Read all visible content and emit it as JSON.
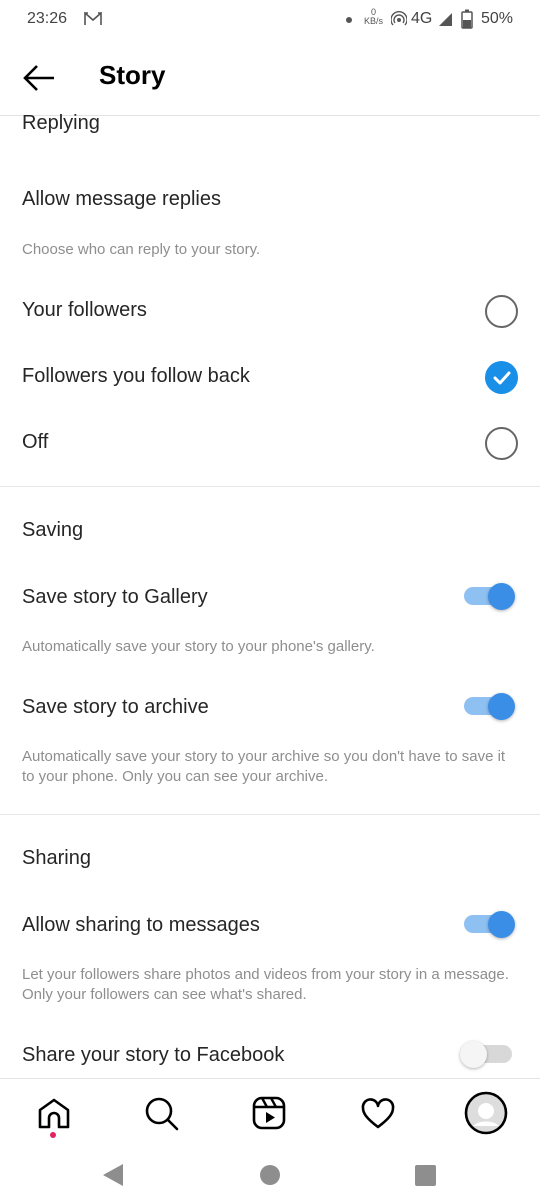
{
  "status_bar": {
    "time": "23:26",
    "notification_icon": "gmail-icon",
    "net_speed_value": "0",
    "net_speed_unit": "KB/s",
    "network": "4G",
    "battery": "50%"
  },
  "header": {
    "title": "Story",
    "back_icon": "arrow-left-icon"
  },
  "replying": {
    "section": "Replying",
    "heading": "Allow message replies",
    "description": "Choose who can reply to your story.",
    "options": [
      {
        "label": "Your followers",
        "selected": false
      },
      {
        "label": "Followers you follow back",
        "selected": true
      },
      {
        "label": "Off",
        "selected": false
      }
    ]
  },
  "saving": {
    "section": "Saving",
    "items": [
      {
        "label": "Save story to Gallery",
        "enabled": true,
        "description": "Automatically save your story to your phone's gallery."
      },
      {
        "label": "Save story to archive",
        "enabled": true,
        "description": "Automatically save your story to your archive so you don't have to save it to your phone. Only you can see your archive."
      }
    ]
  },
  "sharing": {
    "section": "Sharing",
    "items": [
      {
        "label": "Allow sharing to messages",
        "enabled": true,
        "description": "Let your followers share photos and videos from your story in a message. Only your followers can see what's shared."
      },
      {
        "label": "Share your story to Facebook",
        "enabled": false
      }
    ]
  },
  "bottom_nav": [
    "home-icon",
    "search-icon",
    "reels-icon",
    "heart-icon",
    "profile-avatar"
  ],
  "colors": {
    "accent": "#1a8fe8",
    "toggle_on": "#3a8ee6",
    "notification_dot": "#e0245e"
  }
}
